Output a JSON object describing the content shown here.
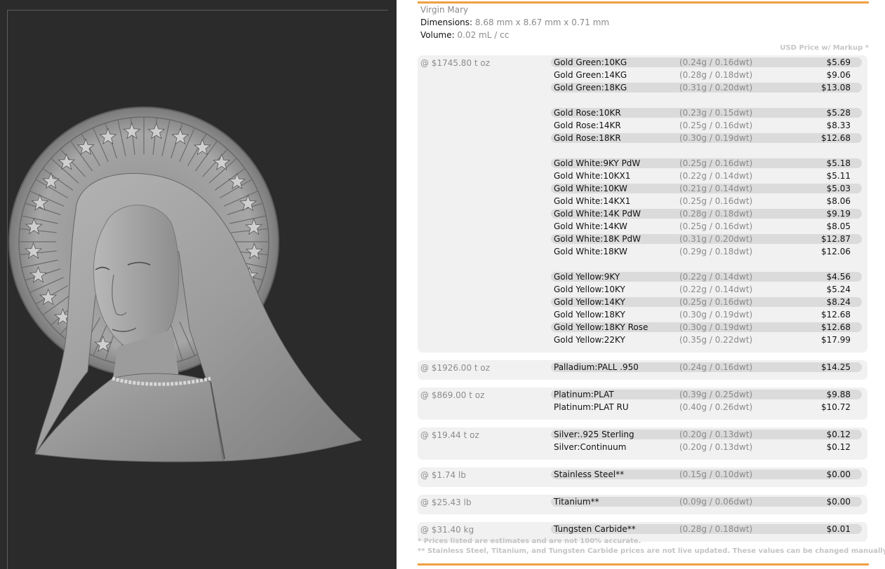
{
  "product": {
    "name": "Virgin Mary",
    "dimensions_label": "Dimensions:",
    "dimensions_value": "8.68 mm x 8.67 mm x 0.71 mm",
    "volume_label": "Volume:",
    "volume_value": "0.02 mL / cc"
  },
  "price_column_label": "USD Price w/ Markup *",
  "groups": [
    {
      "metal_price": "@ $1745.80 t oz",
      "rows": [
        {
          "name": "Gold Green:10KG",
          "weight": "(0.24g / 0.16dwt)",
          "price": "$5.69"
        },
        {
          "name": "Gold Green:14KG",
          "weight": "(0.28g / 0.18dwt)",
          "price": "$9.06"
        },
        {
          "name": "Gold Green:18KG",
          "weight": "(0.31g / 0.20dwt)",
          "price": "$13.08"
        },
        null,
        {
          "name": "Gold Rose:10KR",
          "weight": "(0.23g / 0.15dwt)",
          "price": "$5.28"
        },
        {
          "name": "Gold Rose:14KR",
          "weight": "(0.25g / 0.16dwt)",
          "price": "$8.33"
        },
        {
          "name": "Gold Rose:18KR",
          "weight": "(0.30g / 0.19dwt)",
          "price": "$12.68"
        },
        null,
        {
          "name": "Gold White:9KY PdW",
          "weight": "(0.25g / 0.16dwt)",
          "price": "$5.18"
        },
        {
          "name": "Gold White:10KX1",
          "weight": "(0.22g / 0.14dwt)",
          "price": "$5.11"
        },
        {
          "name": "Gold White:10KW",
          "weight": "(0.21g / 0.14dwt)",
          "price": "$5.03"
        },
        {
          "name": "Gold White:14KX1",
          "weight": "(0.25g / 0.16dwt)",
          "price": "$8.06"
        },
        {
          "name": "Gold White:14K PdW",
          "weight": "(0.28g / 0.18dwt)",
          "price": "$9.19"
        },
        {
          "name": "Gold White:14KW",
          "weight": "(0.25g / 0.16dwt)",
          "price": "$8.05"
        },
        {
          "name": "Gold White:18K PdW",
          "weight": "(0.31g / 0.20dwt)",
          "price": "$12.87"
        },
        {
          "name": "Gold White:18KW",
          "weight": "(0.29g / 0.18dwt)",
          "price": "$12.06"
        },
        null,
        {
          "name": "Gold Yellow:9KY",
          "weight": "(0.22g / 0.14dwt)",
          "price": "$4.56"
        },
        {
          "name": "Gold Yellow:10KY",
          "weight": "(0.22g / 0.14dwt)",
          "price": "$5.24"
        },
        {
          "name": "Gold Yellow:14KY",
          "weight": "(0.25g / 0.16dwt)",
          "price": "$8.24"
        },
        {
          "name": "Gold Yellow:18KY",
          "weight": "(0.30g / 0.19dwt)",
          "price": "$12.68"
        },
        {
          "name": "Gold Yellow:18KY Rose",
          "weight": "(0.30g / 0.19dwt)",
          "price": "$12.68"
        },
        {
          "name": "Gold Yellow:22KY",
          "weight": "(0.35g / 0.22dwt)",
          "price": "$17.99"
        }
      ]
    },
    {
      "metal_price": "@ $1926.00 t oz",
      "rows": [
        {
          "name": "Palladium:PALL .950",
          "weight": "(0.24g / 0.16dwt)",
          "price": "$14.25"
        }
      ]
    },
    {
      "metal_price": "@ $869.00 t oz",
      "rows": [
        {
          "name": "Platinum:PLAT",
          "weight": "(0.39g / 0.25dwt)",
          "price": "$9.88"
        },
        {
          "name": "Platinum:PLAT RU",
          "weight": "(0.40g / 0.26dwt)",
          "price": "$10.72"
        }
      ]
    },
    {
      "metal_price": "@ $19.44 t oz",
      "rows": [
        {
          "name": "Silver:.925 Sterling",
          "weight": "(0.20g / 0.13dwt)",
          "price": "$0.12"
        },
        {
          "name": "Silver:Continuum",
          "weight": "(0.20g / 0.13dwt)",
          "price": "$0.12"
        }
      ]
    },
    {
      "metal_price": "@ $1.74 lb",
      "rows": [
        {
          "name": "Stainless Steel**",
          "weight": "(0.15g / 0.10dwt)",
          "price": "$0.00"
        }
      ]
    },
    {
      "metal_price": "@ $25.43 lb",
      "rows": [
        {
          "name": "Titanium**",
          "weight": "(0.09g / 0.06dwt)",
          "price": "$0.00"
        }
      ]
    },
    {
      "metal_price": "@ $31.40 kg",
      "rows": [
        {
          "name": "Tungsten Carbide**",
          "weight": "(0.28g / 0.18dwt)",
          "price": "$0.01"
        }
      ]
    }
  ],
  "footnotes": [
    "* Prices listed are estimates and are not 100% accurate.",
    "** Stainless Steel, Titanium, and Tungsten Carbide prices are not live updated. These values can be changed manually."
  ],
  "colors": {
    "accent": "#f0a040",
    "viewport_bg": "#2b2b2b",
    "group_bg": "#f1f1f1",
    "row_shade": "#dbdbdb",
    "muted_text": "#8a8a8a"
  }
}
